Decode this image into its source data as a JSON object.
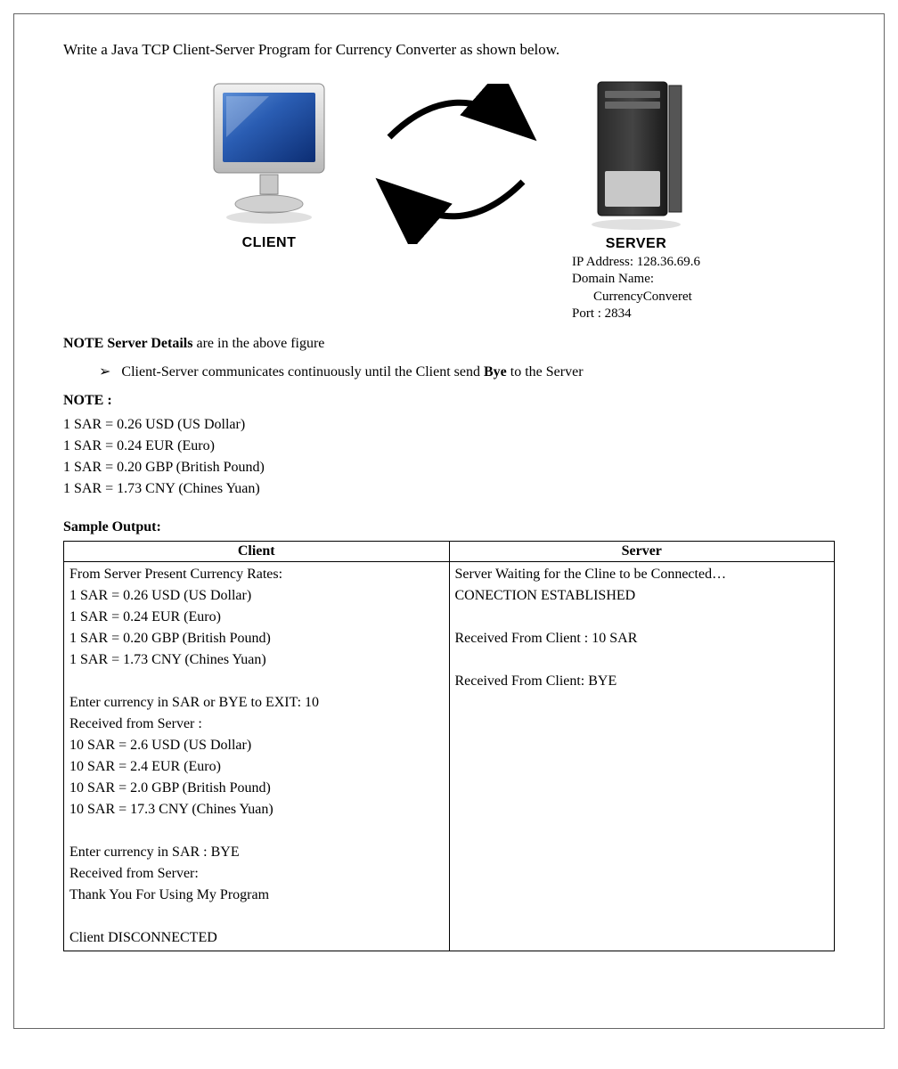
{
  "title": "Write a Java TCP Client-Server Program for Currency Converter as shown below.",
  "diagram": {
    "client_label": "CLIENT",
    "server_label": "SERVER",
    "server_ip_line": "IP Address: 128.36.69.6",
    "server_domain_label": "Domain Name:",
    "server_domain_value": "CurrencyConveret",
    "server_port_line": "Port : 2834"
  },
  "note1_prefix": "NOTE Server Details",
  "note1_suffix": " are in the above figure",
  "bullet_prefix": "Client-Server communicates continuously until the Client send ",
  "bullet_bold": "Bye",
  "bullet_suffix": " to the Server",
  "note2_label": "NOTE :",
  "rates": [
    "1 SAR =  0.26 USD (US Dollar)",
    "1 SAR =  0.24 EUR (Euro)",
    "1 SAR =  0.20 GBP (British Pound)",
    "1 SAR = 1.73 CNY (Chines Yuan)"
  ],
  "sample_label": "Sample Output:",
  "table": {
    "client_header": "Client",
    "server_header": "Server",
    "client_cell": "From Server Present Currency Rates:\n1 SAR =  0.26 USD (US Dollar)\n1 SAR =  0.24 EUR (Euro)\n1 SAR =  0.20 GBP (British Pound)\n1 SAR = 1.73 CNY (Chines Yuan)\n\nEnter currency in SAR or BYE to EXIT: 10\nReceived from Server :\n10 SAR =  2.6 USD (US Dollar)\n10 SAR =  2.4 EUR (Euro)\n10 SAR =  2.0 GBP (British Pound)\n10 SAR = 17.3 CNY (Chines Yuan)\n\nEnter currency in SAR : BYE\nReceived from Server:\nThank You For Using My Program\n\nClient DISCONNECTED",
    "server_cell": "Server Waiting for the Cline to be Connected…\nCONECTION ESTABLISHED\n\nReceived From Client : 10 SAR\n\nReceived From Client: BYE"
  }
}
